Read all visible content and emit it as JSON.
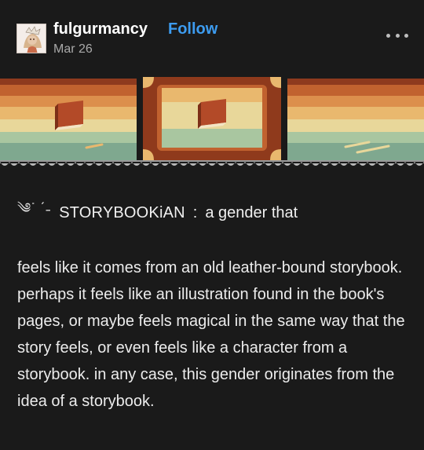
{
  "post": {
    "username": "fulgurmancy",
    "follow_label": "Follow",
    "date": "Mar 26",
    "more_icon": "ellipsis-icon",
    "avatar_icon": "avatar-illustration"
  },
  "content": {
    "decoration": "༄ᣞ ˊ˗",
    "term": "STORYBOOKiAN",
    "separator": ":",
    "definition": "a gender that",
    "body": "feels like it comes from an old leather-bound storybook.  perhaps it feels like an illustration found in the book's pages, or maybe feels magical in the same way that the story feels, or even feels like a character from a storybook.  in any case, this gender originates from the idea of a storybook."
  },
  "banner": {
    "icon": "book-icon",
    "stripe_colors": [
      "#8e3a1e",
      "#c1622f",
      "#dc8f4c",
      "#e9b86e",
      "#e8d79a",
      "#a9c6a0",
      "#7fa88f"
    ],
    "frame_color": "#8f3a1c"
  }
}
